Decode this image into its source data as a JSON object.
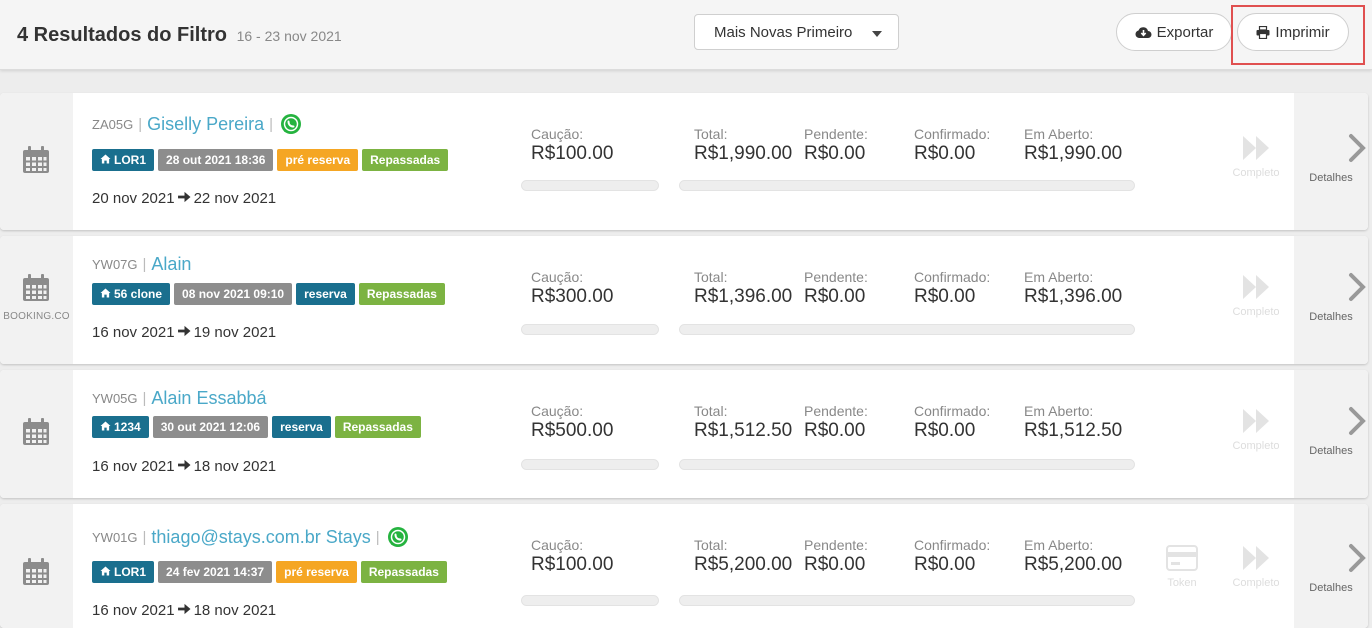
{
  "header": {
    "title": "4 Resultados do Filtro",
    "date_range": "16 - 23 nov 2021",
    "sort_label": "Mais Novas Primeiro",
    "export_label": "Exportar",
    "print_label": "Imprimir"
  },
  "labels": {
    "deposit": "Caução:",
    "total": "Total:",
    "pending": "Pendente:",
    "confirmed": "Confirmado:",
    "open": "Em Aberto:",
    "complete": "Completo",
    "token": "Token",
    "details": "Detalhes"
  },
  "reservations": [
    {
      "id": "ZA05G",
      "guest": "Giselly Pereira",
      "has_whatsapp": true,
      "source": "",
      "listing": "LOR1",
      "created": "28 out 2021 18:36",
      "status": "pré reserva",
      "transfer": "Repassadas",
      "checkin": "20 nov 2021",
      "checkout": "22 nov 2021",
      "deposit": "R$100.00",
      "total": "R$1,990.00",
      "pending": "R$0.00",
      "confirmed": "R$0.00",
      "open": "R$1,990.00"
    },
    {
      "id": "YW07G",
      "guest": "Alain",
      "has_whatsapp": false,
      "source": "BOOKING.CO",
      "listing": "56 clone",
      "created": "08 nov 2021 09:10",
      "status": "reserva",
      "transfer": "Repassadas",
      "checkin": "16 nov 2021",
      "checkout": "19 nov 2021",
      "deposit": "R$300.00",
      "total": "R$1,396.00",
      "pending": "R$0.00",
      "confirmed": "R$0.00",
      "open": "R$1,396.00"
    },
    {
      "id": "YW05G",
      "guest": "Alain Essabbá",
      "has_whatsapp": false,
      "source": "",
      "listing": "1234",
      "created": "30 out 2021 12:06",
      "status": "reserva",
      "transfer": "Repassadas",
      "checkin": "16 nov 2021",
      "checkout": "18 nov 2021",
      "deposit": "R$500.00",
      "total": "R$1,512.50",
      "pending": "R$0.00",
      "confirmed": "R$0.00",
      "open": "R$1,512.50"
    },
    {
      "id": "YW01G",
      "guest": "thiago@stays.com.br Stays",
      "has_whatsapp": true,
      "source": "",
      "listing": "LOR1",
      "created": "24 fev 2021 14:37",
      "status": "pré reserva",
      "transfer": "Repassadas",
      "checkin": "16 nov 2021",
      "checkout": "18 nov 2021",
      "deposit": "R$100.00",
      "total": "R$5,200.00",
      "pending": "R$0.00",
      "confirmed": "R$0.00",
      "open": "R$5,200.00"
    }
  ],
  "icons": {
    "calendar": "calendar-icon",
    "whatsapp": "whatsapp-icon",
    "home": "home-icon",
    "arrow": "arrow-right-icon",
    "complete": "fast-forward-icon",
    "token": "credit-card-icon",
    "details": "chevron-right-icon",
    "export": "cloud-download-icon",
    "print": "printer-icon"
  },
  "colors": {
    "accent": "#4aa8c8",
    "listing_tag": "#1a6f8e",
    "created_tag": "#8d8d8d",
    "pre_tag": "#f5a623",
    "transfer_tag": "#7cb342",
    "highlight": "#e05050"
  }
}
